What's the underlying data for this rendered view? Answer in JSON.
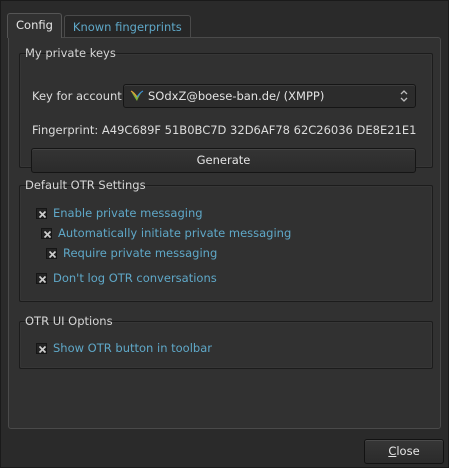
{
  "tabs": [
    {
      "label": "Config",
      "active": true
    },
    {
      "label": "Known fingerprints",
      "active": false
    }
  ],
  "private_keys": {
    "title": "My private keys",
    "account_label": "Key for account:",
    "account_value": "SOdxZ@boese-ban.de/ (XMPP)",
    "account_icon": "xmpp-account-icon",
    "fingerprint_label": "Fingerprint:",
    "fingerprint_value": "A49C689F 51B0BC7D 32D6AF78 62C26036 DE8E21E1",
    "generate_label": "Generate"
  },
  "otr_settings": {
    "title": "Default OTR Settings",
    "options": [
      {
        "label": "Enable private messaging",
        "checked": true
      },
      {
        "label": "Automatically initiate private messaging",
        "checked": true
      },
      {
        "label": "Require private messaging",
        "checked": true
      },
      {
        "label": "Don't log OTR conversations",
        "checked": true
      }
    ]
  },
  "ui_options": {
    "title": "OTR UI Options",
    "options": [
      {
        "label": "Show OTR button in toolbar",
        "checked": true
      }
    ]
  },
  "footer": {
    "close_label_first": "C",
    "close_label_rest": "lose"
  },
  "colors": {
    "background": "#2b2b2b",
    "panel": "#313131",
    "link_text": "#5fa8c8",
    "text": "#d8d8d8"
  }
}
